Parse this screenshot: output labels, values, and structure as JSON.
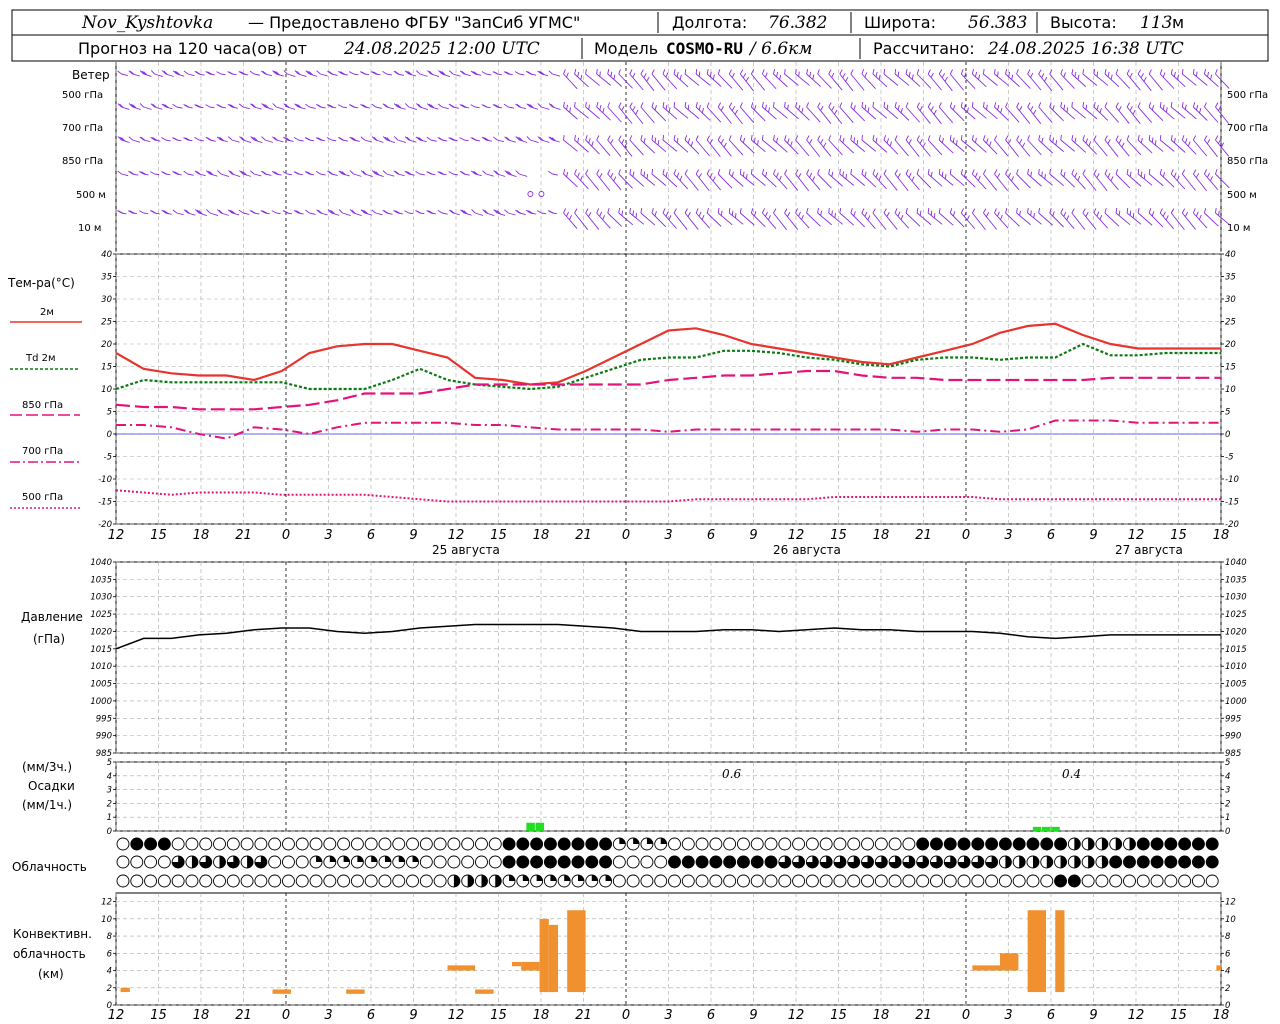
{
  "header": {
    "station": "Nov_Kyshtovka",
    "provided_by": "— Предоставлено ФГБУ \"ЗапСиб УГМС\"",
    "lon_label": "Долгота:",
    "lon_value": "76.382",
    "lat_label": "Широта:",
    "lat_value": "56.383",
    "alt_label": "Высота:",
    "alt_value": "113",
    "alt_unit": "м",
    "forecast_text": "Прогноз на 120 часа(ов) от",
    "forecast_start": "24.08.2025 12:00 UTC",
    "model_label": "Модель",
    "model_name": "COSMO-RU",
    "model_res": "/ 6.6км",
    "calc_label": "Рассчитано:",
    "calc_time": "24.08.2025 16:38 UTC"
  },
  "wind_panel": {
    "title": "Ветер",
    "levels": [
      "500 гПа",
      "700 гПа",
      "850 гПа",
      "500 м",
      "10 м"
    ],
    "right_levels": [
      "500 гПа",
      "700 гПа",
      "850 гПа",
      "500 м",
      "10 м"
    ],
    "barb_color": "#8a2be2"
  },
  "x_axis": {
    "ticks": [
      "12",
      "15",
      "18",
      "21",
      "0",
      "3",
      "6",
      "9",
      "12",
      "15",
      "18",
      "21",
      "0",
      "3",
      "6",
      "9",
      "12",
      "15",
      "18",
      "21",
      "0",
      "3",
      "6",
      "9",
      "12",
      "15",
      "18"
    ],
    "dates": [
      "25 августа",
      "26 августа",
      "27 августа"
    ]
  },
  "temperature_panel": {
    "title": "Тем-ра(°С)",
    "legend": [
      {
        "label": "2м",
        "color": "#e8342e",
        "style": "solid"
      },
      {
        "label": "Td 2м",
        "color": "#0b7a12",
        "style": "dotted"
      },
      {
        "label": "850 гПа",
        "color": "#e0147a",
        "style": "dashed"
      },
      {
        "label": "700 гПа",
        "color": "#e0147a",
        "style": "dashdot"
      },
      {
        "label": "500 гПа",
        "color": "#e0147a",
        "style": "dotted"
      }
    ],
    "y_ticks": [
      "40",
      "35",
      "30",
      "25",
      "20",
      "15",
      "10",
      "5",
      "0",
      "-5",
      "-10",
      "-15",
      "-20"
    ]
  },
  "pressure_panel": {
    "title_line1": "Давление",
    "title_line2": "(гПа)",
    "y_ticks": [
      "1040",
      "1035",
      "1030",
      "1025",
      "1020",
      "1015",
      "1010",
      "1005",
      "1000",
      "995",
      "990",
      "985"
    ]
  },
  "precip_panel": {
    "label_line1": "(мм/3ч.)",
    "label_line2": "Осадки",
    "label_line3": "(мм/1ч.)",
    "y_ticks": [
      "5",
      "4",
      "3",
      "2",
      "1",
      "0"
    ],
    "annotations": [
      "0.6",
      "0.4"
    ],
    "bar_color": "#22dd22"
  },
  "cloud_panel": {
    "title": "Облачность"
  },
  "convective_panel": {
    "title_line1": "Конвективн.",
    "title_line2": "облачность",
    "title_line3": "(км)",
    "y_ticks": [
      "12",
      "10",
      "8",
      "6",
      "4",
      "2",
      "0"
    ],
    "bar_color": "#f0902e"
  },
  "chart_data": [
    {
      "type": "line",
      "title": "Тем-ра(°С)",
      "x_hours": [
        0,
        3,
        6,
        9,
        12,
        15,
        18,
        21,
        24,
        27,
        30,
        33,
        36,
        39,
        42,
        45,
        48,
        51,
        54,
        57,
        60,
        63,
        66,
        69,
        72,
        75,
        78,
        81,
        84,
        87,
        90,
        93,
        96,
        99,
        102,
        105,
        108,
        111,
        114,
        117,
        120
      ],
      "ylim": [
        -20,
        40
      ],
      "series": [
        {
          "name": "2м",
          "values": [
            18,
            14.5,
            13.5,
            13,
            13,
            12,
            14,
            18,
            19.5,
            20,
            20,
            18.5,
            17,
            12.5,
            12,
            11,
            11.5,
            14,
            17,
            20,
            23,
            23.5,
            22,
            20,
            19,
            18,
            17,
            16,
            15.5,
            17,
            18.5,
            20,
            22.5,
            24,
            24.5,
            22,
            20,
            19,
            19,
            19,
            19
          ]
        },
        {
          "name": "Td 2м",
          "values": [
            10,
            12,
            11.5,
            11.5,
            11.5,
            11.5,
            11.5,
            10,
            10,
            10,
            12,
            14.5,
            12,
            11,
            10.5,
            10,
            10.5,
            12.5,
            14.5,
            16.5,
            17,
            17,
            18.5,
            18.5,
            18,
            17,
            16.5,
            15.5,
            15,
            16.5,
            17,
            17,
            16.5,
            17,
            17,
            20,
            17.5,
            17.5,
            18,
            18,
            18
          ]
        },
        {
          "name": "850 гПа",
          "values": [
            6.5,
            6,
            6,
            5.5,
            5.5,
            5.5,
            6,
            6.5,
            7.5,
            9,
            9,
            9,
            10,
            11,
            11,
            11,
            11,
            11,
            11,
            11,
            12,
            12.5,
            13,
            13,
            13.5,
            14,
            14,
            13,
            12.5,
            12.5,
            12,
            12,
            12,
            12,
            12,
            12,
            12.5,
            12.5,
            12.5,
            12.5,
            12.5
          ]
        },
        {
          "name": "700 гПа",
          "values": [
            2,
            2,
            1.5,
            0,
            -1,
            1.5,
            1,
            0,
            1.5,
            2.5,
            2.5,
            2.5,
            2.5,
            2,
            2,
            1.5,
            1,
            1,
            1,
            1,
            0.5,
            1,
            1,
            1,
            1,
            1,
            1,
            1,
            1,
            0.5,
            1,
            1,
            0.5,
            1,
            3,
            3,
            3,
            2.5,
            2.5,
            2.5,
            2.5
          ]
        },
        {
          "name": "500 гПа",
          "values": [
            -12.5,
            -13,
            -13.5,
            -13,
            -13,
            -13,
            -13.5,
            -13.5,
            -13.5,
            -13.5,
            -14,
            -14.5,
            -15,
            -15,
            -15,
            -15,
            -15,
            -15,
            -15,
            -15,
            -15,
            -14.5,
            -14.5,
            -14.5,
            -14.5,
            -14.5,
            -14,
            -14,
            -14,
            -14,
            -14,
            -14,
            -14.5,
            -14.5,
            -14.5,
            -14.5,
            -14.5,
            -14.5,
            -14.5,
            -14.5,
            -14.5
          ]
        }
      ]
    },
    {
      "type": "line",
      "title": "Давление (гПа)",
      "x_hours": [
        0,
        3,
        6,
        9,
        12,
        15,
        18,
        21,
        24,
        27,
        30,
        33,
        36,
        39,
        42,
        45,
        48,
        51,
        54,
        57,
        60,
        63,
        66,
        69,
        72,
        75,
        78,
        81,
        84,
        87,
        90,
        93,
        96,
        99,
        102,
        105,
        108,
        111,
        114,
        117,
        120
      ],
      "ylim": [
        985,
        1040
      ],
      "series": [
        {
          "name": "Давление",
          "values": [
            1015,
            1018,
            1018,
            1019,
            1019.5,
            1020.5,
            1021,
            1021,
            1020,
            1019.5,
            1020,
            1021,
            1021.5,
            1022,
            1022,
            1022,
            1022,
            1021.5,
            1021,
            1020,
            1020,
            1020,
            1020.5,
            1020.5,
            1020,
            1020.5,
            1021,
            1020.5,
            1020.5,
            1020,
            1020,
            1020,
            1019.5,
            1018.5,
            1018,
            1018.5,
            1019,
            1019,
            1019,
            1019,
            1019
          ]
        }
      ]
    },
    {
      "type": "bar",
      "title": "Осадки",
      "ylim": [
        0,
        5
      ],
      "x_hours": [
        45,
        46,
        100,
        101,
        102
      ],
      "values": [
        0.6,
        0.6,
        0.3,
        0.3,
        0.3
      ]
    },
    {
      "type": "bar",
      "title": "Конвективн. облачность (км)",
      "ylim": [
        0,
        13
      ],
      "bars": [
        {
          "x_start": 0.5,
          "x_end": 1.5,
          "bottom": 1.5,
          "top": 2
        },
        {
          "x_start": 17,
          "x_end": 19,
          "bottom": 1.3,
          "top": 1.8
        },
        {
          "x_start": 25,
          "x_end": 27,
          "bottom": 1.3,
          "top": 1.8
        },
        {
          "x_start": 36,
          "x_end": 39,
          "bottom": 4.0,
          "top": 4.6
        },
        {
          "x_start": 39,
          "x_end": 41,
          "bottom": 1.3,
          "top": 1.8
        },
        {
          "x_start": 43,
          "x_end": 44,
          "bottom": 4.5,
          "top": 5.0
        },
        {
          "x_start": 44,
          "x_end": 46,
          "bottom": 4.0,
          "top": 5.0
        },
        {
          "x_start": 46,
          "x_end": 47,
          "bottom": 1.5,
          "top": 10.0
        },
        {
          "x_start": 47,
          "x_end": 48,
          "bottom": 1.5,
          "top": 9.3
        },
        {
          "x_start": 49,
          "x_end": 51,
          "bottom": 1.5,
          "top": 11.0
        },
        {
          "x_start": 93,
          "x_end": 96,
          "bottom": 4.0,
          "top": 4.6
        },
        {
          "x_start": 96,
          "x_end": 98,
          "bottom": 4.0,
          "top": 6.0
        },
        {
          "x_start": 99,
          "x_end": 101,
          "bottom": 1.5,
          "top": 11.0
        },
        {
          "x_start": 102,
          "x_end": 103,
          "bottom": 1.5,
          "top": 11.0
        },
        {
          "x_start": 119.5,
          "x_end": 120,
          "bottom": 4.0,
          "top": 4.6
        }
      ]
    }
  ]
}
